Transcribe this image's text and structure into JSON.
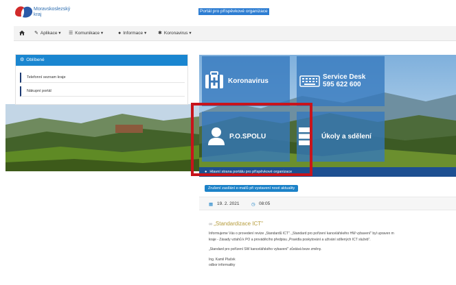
{
  "header": {
    "brand_line1": "Moravskoslezský",
    "brand_line2": "kraj",
    "portal_title": "Portál pro příspěvkové organizace"
  },
  "nav": {
    "home_icon": "home-icon",
    "items": [
      {
        "label": "Aplikace ▾",
        "icon": "pencil-icon"
      },
      {
        "label": "Komunikace ▾",
        "icon": "list-icon"
      },
      {
        "label": "Informace ▾",
        "icon": "info-icon"
      },
      {
        "label": "Koronavirus ▾",
        "icon": "virus-icon"
      }
    ]
  },
  "favorites": {
    "title": "Oblíbené",
    "items": [
      "Telefonní seznam kraje",
      "Nákupní portál"
    ]
  },
  "tiles": {
    "koronavirus": "Koronavirus",
    "service_desk_line1": "Service Desk",
    "service_desk_line2": "595 622 600",
    "pospolu": "P.O.SPOLU",
    "ukoly": "Úkoly a sdělení"
  },
  "infobar": {
    "text": "Hlavní strana portálu pro příspěvkové organizace"
  },
  "content": {
    "unsubscribe_label": "Zrušení zasílání e-mailů při vystavení nové aktuality",
    "date": "19. 2. 2021",
    "time": "08:05",
    "article_title": "„Standardizace ICT\"",
    "line1": "Informujeme Vás o provedení revize „Standardů ICT\". „Standard pro pořízení kancelářského HW vybavení\" byl upraven m",
    "line2": "kraje - Zásady vztahů k PO a prováděcího předpisu „Pravidla poskytování a užívání sdílených ICT služeb\".",
    "line3": "„Standard pro pořízení SW kancelářského vybavení\" zůstává beze změny.",
    "sign1": "Ing. Kamil Plaček",
    "sign2": "odbor informatiky"
  },
  "colors": {
    "accent": "#1a86d0",
    "dark_blue": "#1d4f91",
    "highlight_red": "#c8141b",
    "tile_blue": "#3478be"
  }
}
